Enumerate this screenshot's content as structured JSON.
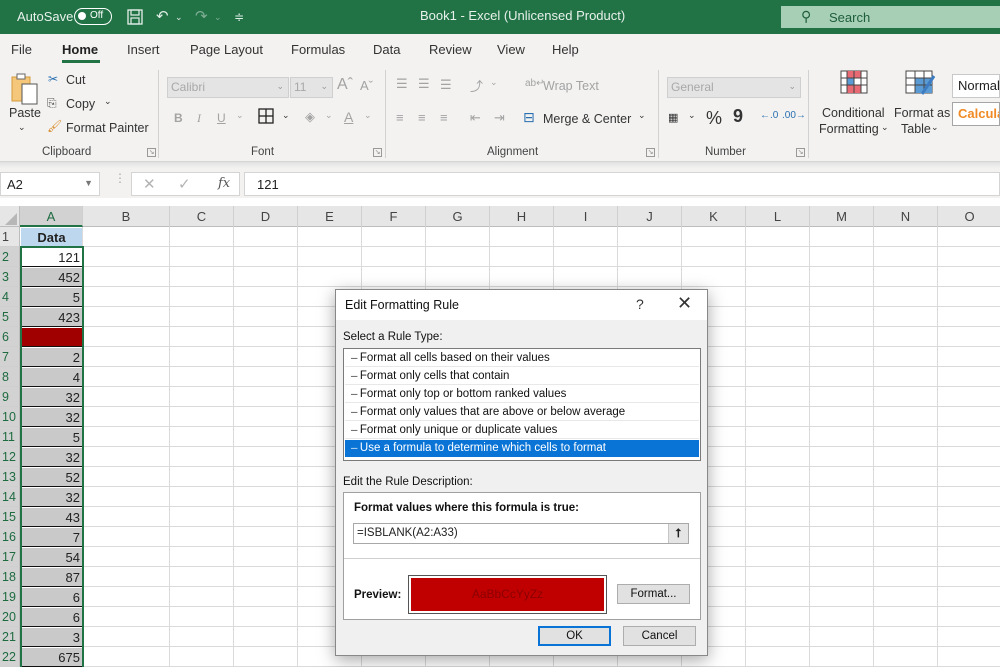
{
  "titlebar": {
    "autosave_label": "AutoSave",
    "autosave_state": "Off",
    "title": "Book1  -  Excel (Unlicensed Product)",
    "search_placeholder": "Search",
    "icons": [
      "save-icon",
      "undo-icon",
      "redo-icon",
      "customize-qat-icon"
    ]
  },
  "ribbon_tabs": [
    {
      "label": "File"
    },
    {
      "label": "Home",
      "active": true
    },
    {
      "label": "Insert"
    },
    {
      "label": "Page Layout"
    },
    {
      "label": "Formulas"
    },
    {
      "label": "Data"
    },
    {
      "label": "Review"
    },
    {
      "label": "View"
    },
    {
      "label": "Help"
    }
  ],
  "ribbon": {
    "clipboard": {
      "label": "Clipboard",
      "paste": "Paste",
      "cut": "Cut",
      "copy": "Copy",
      "format_painter": "Format Painter"
    },
    "font": {
      "label": "Font",
      "font_name": "Calibri",
      "font_size": "11",
      "bold": "B",
      "italic": "I",
      "underline": "U"
    },
    "alignment": {
      "label": "Alignment",
      "wrap_text": "Wrap Text",
      "merge_center": "Merge & Center"
    },
    "number": {
      "label": "Number",
      "format": "General",
      "percent": "%",
      "comma": "9"
    },
    "styles": {
      "conditional_formatting_1": "Conditional",
      "conditional_formatting_2": "Formatting",
      "format_as_table_1": "Format as",
      "format_as_table_2": "Table",
      "style_normal": "Normal",
      "style_calculation": "Calculation"
    }
  },
  "formula_bar": {
    "name_box": "A2",
    "fx": "fx",
    "value": "121"
  },
  "sheet": {
    "columns": [
      "A",
      "B",
      "C",
      "D",
      "E",
      "F",
      "G",
      "H",
      "I",
      "J",
      "K",
      "L",
      "M",
      "N",
      "O"
    ],
    "rows": [
      "1",
      "2",
      "3",
      "4",
      "5",
      "6",
      "7",
      "8",
      "9",
      "10",
      "11",
      "12",
      "13",
      "14",
      "15",
      "16",
      "17",
      "18",
      "19",
      "20",
      "21",
      "22"
    ],
    "column_a": [
      "Data",
      "121",
      "452",
      "5",
      "423",
      "",
      "2",
      "4",
      "32",
      "32",
      "5",
      "32",
      "52",
      "32",
      "43",
      "7",
      "54",
      "87",
      "6",
      "6",
      "3",
      "675"
    ],
    "highlight_color": "#a00000",
    "shade_color": "#c9c9c9"
  },
  "dialog": {
    "title": "Edit Formatting Rule",
    "help": "?",
    "select_rule_label": "Select a Rule Type:",
    "rule_types": [
      "Format all cells based on their values",
      "Format only cells that contain",
      "Format only top or bottom ranked values",
      "Format only values that are above or below average",
      "Format only unique or duplicate values",
      "Use a formula to determine which cells to format"
    ],
    "selected_rule_index": 5,
    "edit_desc_label": "Edit the Rule Description:",
    "formula_label": "Format values where this formula is true:",
    "formula": "=ISBLANK(A2:A33)",
    "preview_label": "Preview:",
    "preview_text": "AaBbCcYyZz",
    "preview_fill": "#c00000",
    "format_button": "Format...",
    "ok_button": "OK",
    "cancel_button": "Cancel"
  }
}
